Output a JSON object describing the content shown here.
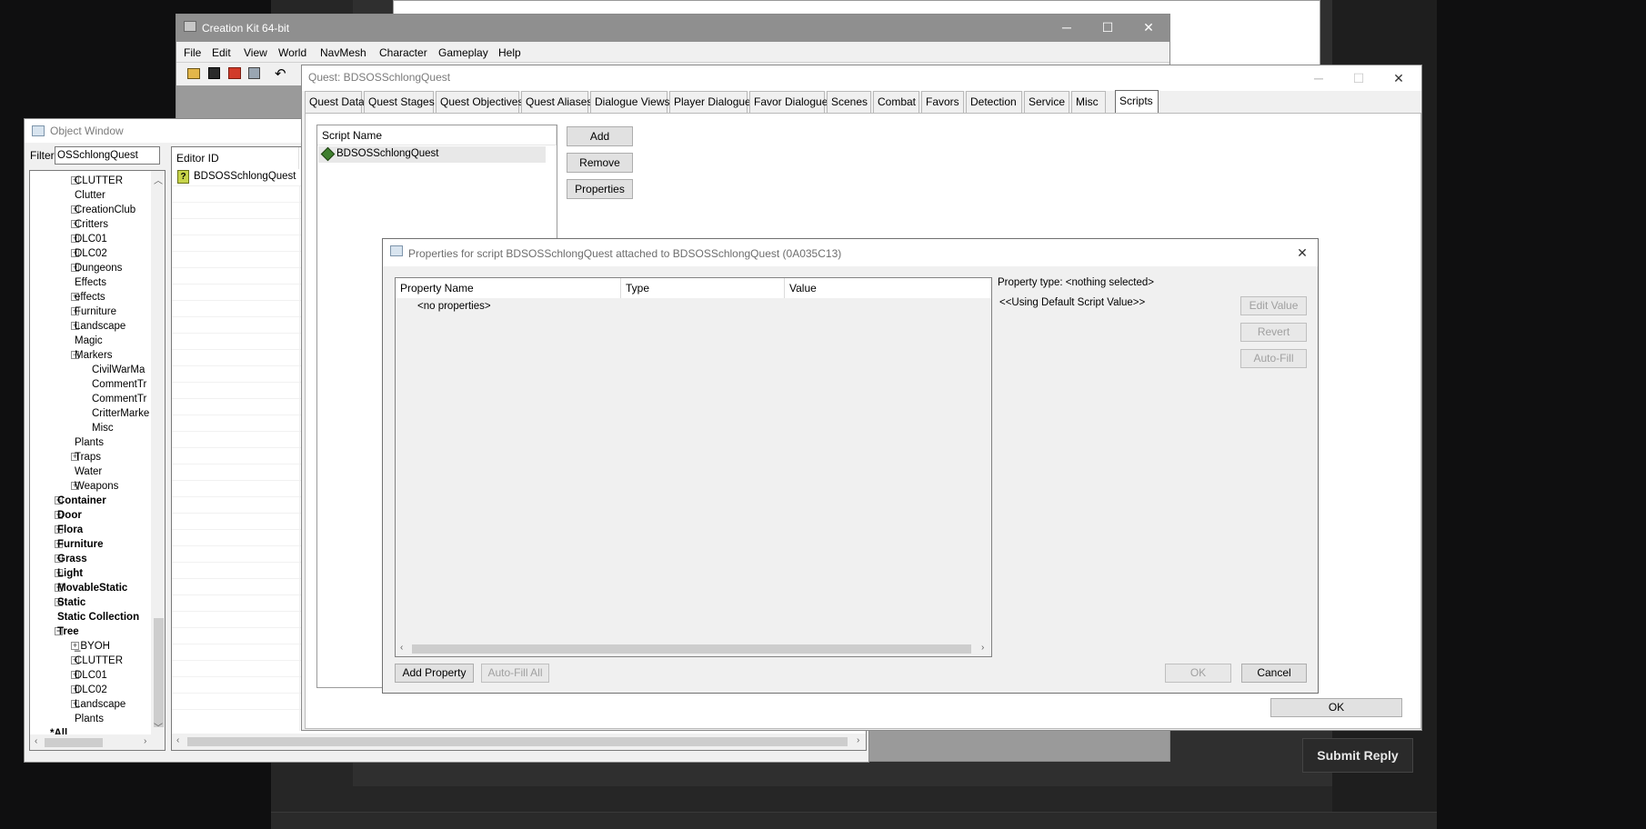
{
  "background": {
    "submit_label": "Submit Reply"
  },
  "ck": {
    "title": "Creation Kit 64-bit",
    "menu": [
      "File",
      "Edit",
      "View",
      "World",
      "NavMesh",
      "Character",
      "Gameplay",
      "Help"
    ]
  },
  "object_window": {
    "title": "Object Window",
    "filter_label": "Filter",
    "filter_value": "OSSchlongQuest",
    "tree": [
      {
        "label": "CLUTTER",
        "level": 2,
        "exp": "+",
        "bold": false
      },
      {
        "label": "Clutter",
        "level": 2,
        "exp": "",
        "bold": false
      },
      {
        "label": "CreationClub",
        "level": 2,
        "exp": "+",
        "bold": false
      },
      {
        "label": "Critters",
        "level": 2,
        "exp": "+",
        "bold": false
      },
      {
        "label": "DLC01",
        "level": 2,
        "exp": "+",
        "bold": false
      },
      {
        "label": "DLC02",
        "level": 2,
        "exp": "+",
        "bold": false
      },
      {
        "label": "Dungeons",
        "level": 2,
        "exp": "+",
        "bold": false
      },
      {
        "label": "Effects",
        "level": 2,
        "exp": "",
        "bold": false
      },
      {
        "label": "effects",
        "level": 2,
        "exp": "+",
        "bold": false
      },
      {
        "label": "Furniture",
        "level": 2,
        "exp": "+",
        "bold": false
      },
      {
        "label": "Landscape",
        "level": 2,
        "exp": "+",
        "bold": false
      },
      {
        "label": "Magic",
        "level": 2,
        "exp": "",
        "bold": false
      },
      {
        "label": "Markers",
        "level": 2,
        "exp": "-",
        "bold": false
      },
      {
        "label": "CivilWarMa",
        "level": 3,
        "exp": "",
        "bold": false
      },
      {
        "label": "CommentTr",
        "level": 3,
        "exp": "",
        "bold": false
      },
      {
        "label": "CommentTr",
        "level": 3,
        "exp": "",
        "bold": false
      },
      {
        "label": "CritterMarke",
        "level": 3,
        "exp": "",
        "bold": false
      },
      {
        "label": "Misc",
        "level": 3,
        "exp": "",
        "bold": false
      },
      {
        "label": "Plants",
        "level": 2,
        "exp": "",
        "bold": false
      },
      {
        "label": "Traps",
        "level": 2,
        "exp": "+",
        "bold": false
      },
      {
        "label": "Water",
        "level": 2,
        "exp": "",
        "bold": false
      },
      {
        "label": "Weapons",
        "level": 2,
        "exp": "+",
        "bold": false
      },
      {
        "label": "Container",
        "level": 1,
        "exp": "+",
        "bold": true
      },
      {
        "label": "Door",
        "level": 1,
        "exp": "+",
        "bold": true
      },
      {
        "label": "Flora",
        "level": 1,
        "exp": "+",
        "bold": true
      },
      {
        "label": "Furniture",
        "level": 1,
        "exp": "+",
        "bold": true
      },
      {
        "label": "Grass",
        "level": 1,
        "exp": "+",
        "bold": true
      },
      {
        "label": "Light",
        "level": 1,
        "exp": "+",
        "bold": true
      },
      {
        "label": "MovableStatic",
        "level": 1,
        "exp": "+",
        "bold": true
      },
      {
        "label": "Static",
        "level": 1,
        "exp": "+",
        "bold": true
      },
      {
        "label": "Static Collection",
        "level": 1,
        "exp": "",
        "bold": true
      },
      {
        "label": "Tree",
        "level": 1,
        "exp": "-",
        "bold": true
      },
      {
        "label": "_BYOH",
        "level": 2,
        "exp": "+",
        "bold": false
      },
      {
        "label": "CLUTTER",
        "level": 2,
        "exp": "+",
        "bold": false
      },
      {
        "label": "DLC01",
        "level": 2,
        "exp": "+",
        "bold": false
      },
      {
        "label": "DLC02",
        "level": 2,
        "exp": "+",
        "bold": false
      },
      {
        "label": "Landscape",
        "level": 2,
        "exp": "+",
        "bold": false
      },
      {
        "label": "Plants",
        "level": 2,
        "exp": "",
        "bold": false
      },
      {
        "label": "*All",
        "level": 0,
        "exp": "",
        "bold": true
      }
    ],
    "editor_id_header": "Editor ID",
    "entry": "BDSOSSchlongQuest"
  },
  "quest": {
    "title": "Quest: BDSOSSchlongQuest",
    "tabs": [
      "Quest Data",
      "Quest Stages",
      "Quest Objectives",
      "Quest Aliases",
      "Dialogue Views",
      "Player Dialogue",
      "Favor Dialogue",
      "Scenes",
      "Combat",
      "Favors",
      "Detection",
      "Service",
      "Misc",
      "Scripts"
    ],
    "active_tab": "Scripts",
    "script_name_header": "Script Name",
    "script": "BDSOSSchlongQuest",
    "add": "Add",
    "remove": "Remove",
    "properties": "Properties",
    "ok": "OK"
  },
  "props": {
    "title": "Properties for script BDSOSSchlongQuest attached to BDSOSSchlongQuest (0A035C13)",
    "col_name": "Property Name",
    "col_type": "Type",
    "col_value": "Value",
    "empty": "<no properties>",
    "type_text": "Property type: <nothing selected>",
    "default_text": "<<Using Default Script Value>>",
    "edit_value": "Edit Value",
    "revert": "Revert",
    "auto_fill": "Auto-Fill",
    "add_property": "Add Property",
    "auto_fill_all": "Auto-Fill All",
    "ok": "OK",
    "cancel": "Cancel"
  }
}
